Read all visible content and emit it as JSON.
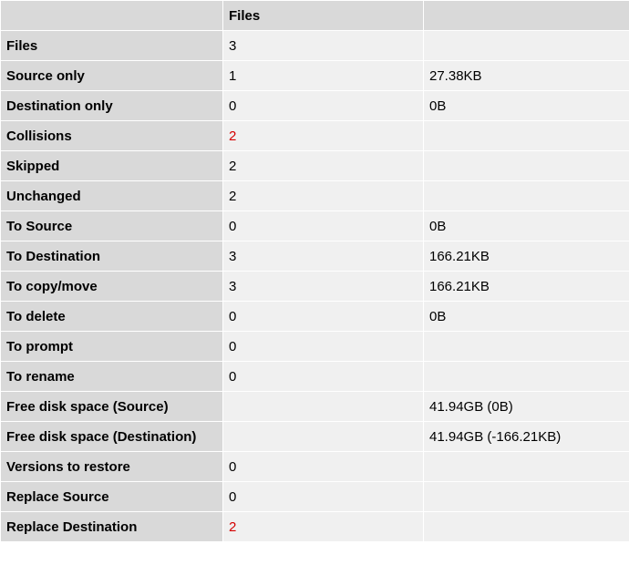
{
  "headers": {
    "blank": "",
    "files": "Files",
    "size": ""
  },
  "rows": {
    "files": {
      "label": "Files",
      "files": "3",
      "size": ""
    },
    "source_only": {
      "label": "Source only",
      "files": "1",
      "size": "27.38KB"
    },
    "destination_only": {
      "label": "Destination only",
      "files": "0",
      "size": "0B"
    },
    "collisions": {
      "label": "Collisions",
      "files": "2",
      "size": ""
    },
    "skipped": {
      "label": "Skipped",
      "files": "2",
      "size": ""
    },
    "unchanged": {
      "label": "Unchanged",
      "files": "2",
      "size": ""
    },
    "to_source": {
      "label": "To Source",
      "files": "0",
      "size": "0B"
    },
    "to_destination": {
      "label": "To Destination",
      "files": "3",
      "size": "166.21KB"
    },
    "to_copy_move": {
      "label": "To copy/move",
      "files": "3",
      "size": "166.21KB"
    },
    "to_delete": {
      "label": "To delete",
      "files": "0",
      "size": "0B"
    },
    "to_prompt": {
      "label": "To prompt",
      "files": "0",
      "size": ""
    },
    "to_rename": {
      "label": "To rename",
      "files": "0",
      "size": ""
    },
    "free_src": {
      "label": "Free disk space (Source)",
      "files": "",
      "size": "41.94GB (0B)"
    },
    "free_dst": {
      "label": "Free disk space (Destination)",
      "files": "",
      "size": "41.94GB (-166.21KB)"
    },
    "versions_restore": {
      "label": "Versions to restore",
      "files": "0",
      "size": ""
    },
    "replace_source": {
      "label": "Replace Source",
      "files": "0",
      "size": ""
    },
    "replace_destination": {
      "label": "Replace Destination",
      "files": "2",
      "size": ""
    }
  }
}
